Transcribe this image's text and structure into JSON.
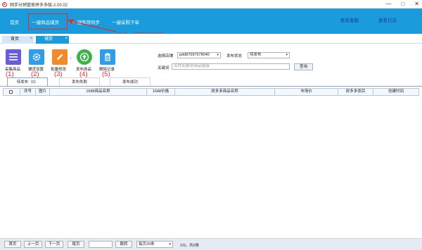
{
  "window": {
    "title": "网手分销管家拼多多版-2.00.02",
    "controls": [
      "—",
      "□",
      "✕"
    ]
  },
  "topnav": {
    "items": [
      {
        "label": "首页"
      },
      {
        "label": "一键商品铺货"
      },
      {
        "label": "一键库存同步"
      },
      {
        "label": "一键采购下单"
      }
    ],
    "links": [
      {
        "label": "联系客服"
      },
      {
        "label": "查看日志"
      }
    ]
  },
  "annotation": {
    "text": "点击一键商品铺货",
    "color": "#e62a2a"
  },
  "tabs": [
    {
      "label": "首页",
      "close": "×"
    },
    {
      "label": "铺货",
      "close": "×"
    }
  ],
  "toolbar": {
    "buttons": [
      {
        "label": "采集商品",
        "icon": "list-icon",
        "num": "(1)",
        "color": "#6a5bd6"
      },
      {
        "label": "铺货设置",
        "icon": "gear-icon",
        "num": "(2)",
        "color": "#2f9ee8"
      },
      {
        "label": "批量修改",
        "icon": "pencil-icon",
        "num": "(3)",
        "color": "#f08a2a"
      },
      {
        "label": "发布商品",
        "icon": "upload-icon",
        "num": "(4)",
        "color": "#3cb34a"
      },
      {
        "label": "删除记录",
        "icon": "trash-icon",
        "num": "(5)",
        "color": "#2f9ee8"
      }
    ],
    "dot": "·"
  },
  "filters": {
    "store_label": "选择店铺",
    "store_value": "pdd87097678040",
    "status_label": "发布状态",
    "status_value": "待发布",
    "keyword_label": "关键词",
    "keyword_placeholder": "名称关键词\\商品链接",
    "search_button": "查询"
  },
  "subtabs": [
    {
      "label": "待发布（0）"
    },
    {
      "label": "发布失败"
    },
    {
      "label": "发布成功"
    }
  ],
  "table": {
    "columns": [
      "序号",
      "图片",
      "1688商品名称",
      "1688价格",
      "拼多多商品名称",
      "市场价",
      "拼多多类目",
      "创建时间"
    ],
    "rows": []
  },
  "pagination": {
    "first": "首页",
    "prev": "上一页",
    "next": "下一页",
    "last": "尾页",
    "jump": "跳转",
    "page_size": "每页20条",
    "info": "1/0，共0条"
  }
}
